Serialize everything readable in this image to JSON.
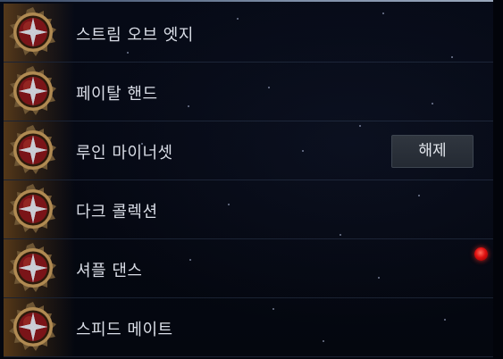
{
  "skills": [
    {
      "name": "스트림 오브 엣지",
      "icon": "compass-star-emblem-icon"
    },
    {
      "name": "페이탈 핸드",
      "icon": "compass-star-emblem-icon"
    },
    {
      "name": "루인 마이너셋",
      "icon": "compass-star-emblem-icon"
    },
    {
      "name": "다크 콜렉션",
      "icon": "compass-star-emblem-icon"
    },
    {
      "name": "셔플 댄스",
      "icon": "compass-star-emblem-icon"
    },
    {
      "name": "스피드 메이트",
      "icon": "compass-star-emblem-icon"
    }
  ],
  "release_button": {
    "label": "해제"
  },
  "colors": {
    "background": "#04070f",
    "emblem_ring": "#b08a52",
    "emblem_core": "#7a1418",
    "accent_glow": "#96601e",
    "notification": "#e01010",
    "button_bg": "#2a3039"
  }
}
